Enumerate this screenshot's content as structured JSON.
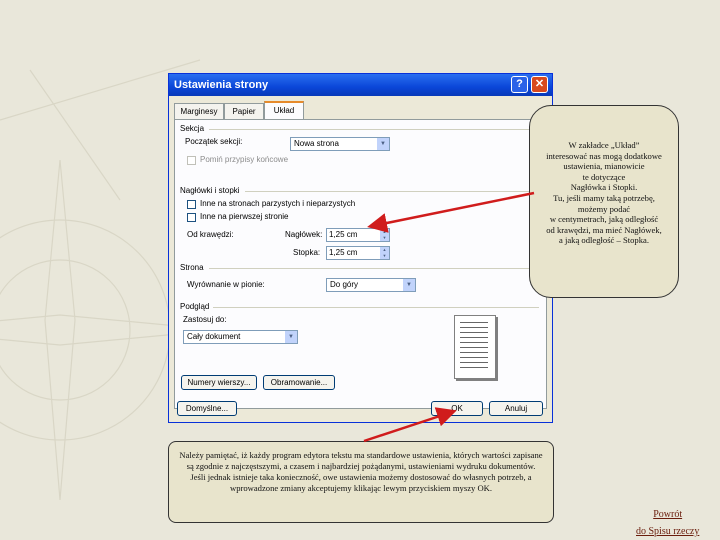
{
  "dialog": {
    "title": "Ustawienia strony",
    "help_button": "?",
    "close_button": "✕",
    "tabs": [
      {
        "label": "Marginesy"
      },
      {
        "label": "Papier"
      },
      {
        "label": "Układ"
      }
    ],
    "sections": {
      "sekcja": {
        "heading": "Sekcja",
        "start_label": "Początek sekcji:",
        "start_value": "Nowa strona",
        "endnotes_label": "Pomiń przypisy końcowe"
      },
      "naglowki": {
        "heading": "Nagłówki i stopki",
        "odd_even_label": "Inne na stronach parzystych i nieparzystych",
        "first_page_label": "Inne na pierwszej stronie",
        "from_edge_label": "Od krawędzi:",
        "header_label": "Nagłówek:",
        "header_value": "1,25 cm",
        "footer_label": "Stopka:",
        "footer_value": "1,25 cm"
      },
      "strona": {
        "heading": "Strona",
        "valign_label": "Wyrównanie w pionie:",
        "valign_value": "Do góry"
      },
      "podglad": {
        "heading": "Podgląd",
        "apply_label": "Zastosuj do:",
        "apply_value": "Cały dokument"
      }
    },
    "buttons": {
      "line_numbers": "Numery wierszy...",
      "borders": "Obramowanie...",
      "default": "Domyślne...",
      "ok": "OK",
      "cancel": "Anuluj"
    }
  },
  "callout_layout": "W zakładce „Układ”\ninteresować nas mogą dodatkowe\nustawienia, mianowicie\nte dotyczące\nNagłówka i Stopki.\nTu, jeśli mamy taką potrzebę,\nmożemy podać\nw centymetrach, jaką odległość\nod krawędzi, ma mieć Nagłówek,\na jaką odległość – Stopka.",
  "note_text": "Należy pamiętać, iż każdy program edytora tekstu ma standardowe ustawienia, których wartości zapisane są zgodnie z najczęstszymi, a czasem i najbardziej pożądanymi, ustawieniami wydruku dokumentów. Jeśli jednak istnieje taka konieczność, owe ustawienia możemy dostosować do własnych potrzeb, a wprowadzone zmiany akceptujemy klikając lewym przyciskiem myszy OK.",
  "back_link": "Powrót\ndo Spisu rzeczy",
  "colors": {
    "arrow": "#d01c1c",
    "titlebar": "#0a46d8",
    "bubble": "#e8e4cc"
  }
}
